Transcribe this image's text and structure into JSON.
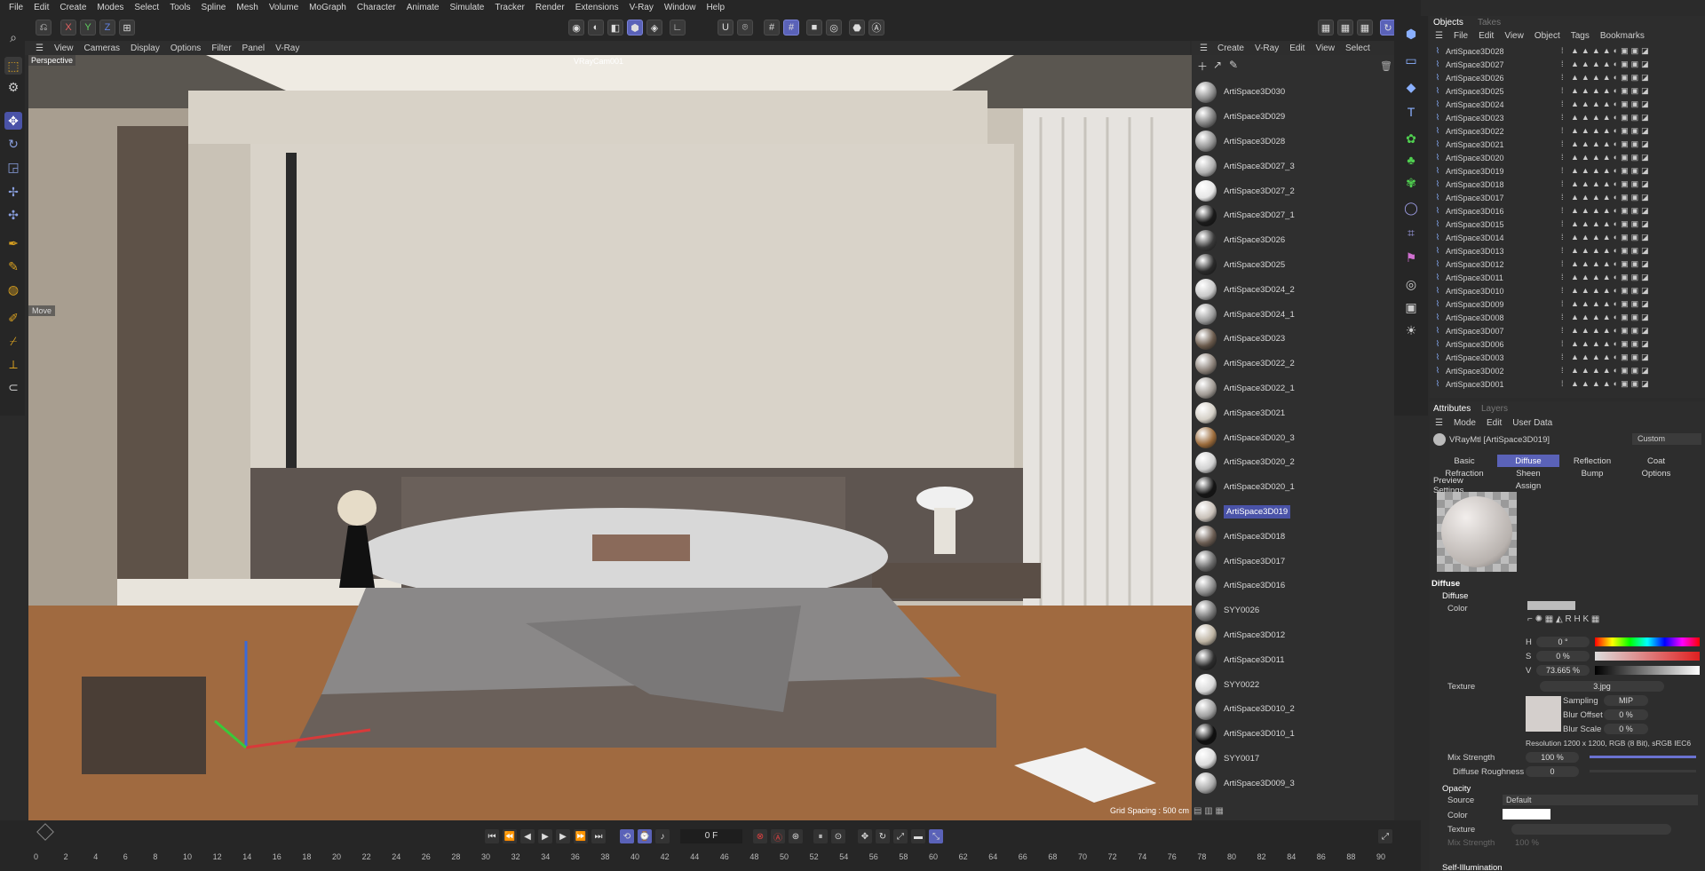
{
  "menu": [
    "File",
    "Edit",
    "Create",
    "Modes",
    "Select",
    "Tools",
    "Spline",
    "Mesh",
    "Volume",
    "MoGraph",
    "Character",
    "Animate",
    "Simulate",
    "Tracker",
    "Render",
    "Extensions",
    "V-Ray",
    "Window",
    "Help"
  ],
  "axis_buttons": [
    "X",
    "Y",
    "Z"
  ],
  "viewport_menu": [
    "View",
    "Cameras",
    "Display",
    "Options",
    "Filter",
    "Panel",
    "V-Ray"
  ],
  "viewport": {
    "name": "Perspective",
    "camera": "VRayCam001",
    "tool_tooltip": "Move",
    "grid_spacing": "Grid Spacing : 500 cm"
  },
  "material_menu": [
    "Create",
    "V-Ray",
    "Edit",
    "View",
    "Select"
  ],
  "materials": [
    {
      "name": "ArtiSpace3D030",
      "color": "#8a8a8a"
    },
    {
      "name": "ArtiSpace3D029",
      "color": "#7c7c7c"
    },
    {
      "name": "ArtiSpace3D028",
      "color": "#909090"
    },
    {
      "name": "ArtiSpace3D027_3",
      "color": "#b0b0b0"
    },
    {
      "name": "ArtiSpace3D027_2",
      "color": "#e6e6e6"
    },
    {
      "name": "ArtiSpace3D027_1",
      "color": "#1a1a1a"
    },
    {
      "name": "ArtiSpace3D026",
      "color": "#3a3a3a"
    },
    {
      "name": "ArtiSpace3D025",
      "color": "#2a2a2a"
    },
    {
      "name": "ArtiSpace3D024_2",
      "color": "#c8c8c8"
    },
    {
      "name": "ArtiSpace3D024_1",
      "color": "#9a9a9a"
    },
    {
      "name": "ArtiSpace3D023",
      "color": "#6a5a4c"
    },
    {
      "name": "ArtiSpace3D022_2",
      "color": "#8a8078"
    },
    {
      "name": "ArtiSpace3D022_1",
      "color": "#a09a94"
    },
    {
      "name": "ArtiSpace3D021",
      "color": "#d4cfc6"
    },
    {
      "name": "ArtiSpace3D020_3",
      "color": "#9a6a3a"
    },
    {
      "name": "ArtiSpace3D020_2",
      "color": "#d0d0d0"
    },
    {
      "name": "ArtiSpace3D020_1",
      "color": "#151515"
    },
    {
      "name": "ArtiSpace3D019",
      "color": "#c8c0b8",
      "selected": true
    },
    {
      "name": "ArtiSpace3D018",
      "color": "#6a5c52"
    },
    {
      "name": "ArtiSpace3D017",
      "color": "#6a6a6a"
    },
    {
      "name": "ArtiSpace3D016",
      "color": "#8a8a8a"
    },
    {
      "name": "SYY0026",
      "color": "#777777"
    },
    {
      "name": "ArtiSpace3D012",
      "color": "#bdb3a2"
    },
    {
      "name": "ArtiSpace3D011",
      "color": "#2d2d2d"
    },
    {
      "name": "SYY0022",
      "color": "#d8d8d8"
    },
    {
      "name": "ArtiSpace3D010_2",
      "color": "#a0a0a0"
    },
    {
      "name": "ArtiSpace3D010_1",
      "color": "#101010"
    },
    {
      "name": "SYY0017",
      "color": "#dcdcdc"
    },
    {
      "name": "ArtiSpace3D009_3",
      "color": "#a8a8a8"
    }
  ],
  "objects_panel": {
    "tabs": [
      "Objects",
      "Takes"
    ],
    "menu": [
      "File",
      "Edit",
      "View",
      "Object",
      "Tags",
      "Bookmarks"
    ],
    "rows": [
      "ArtiSpace3D028",
      "ArtiSpace3D027",
      "ArtiSpace3D026",
      "ArtiSpace3D025",
      "ArtiSpace3D024",
      "ArtiSpace3D023",
      "ArtiSpace3D022",
      "ArtiSpace3D021",
      "ArtiSpace3D020",
      "ArtiSpace3D019",
      "ArtiSpace3D018",
      "ArtiSpace3D017",
      "ArtiSpace3D016",
      "ArtiSpace3D015",
      "ArtiSpace3D014",
      "ArtiSpace3D013",
      "ArtiSpace3D012",
      "ArtiSpace3D011",
      "ArtiSpace3D010",
      "ArtiSpace3D009",
      "ArtiSpace3D008",
      "ArtiSpace3D007",
      "ArtiSpace3D006",
      "ArtiSpace3D003",
      "ArtiSpace3D002",
      "ArtiSpace3D001"
    ]
  },
  "attributes": {
    "tabs": [
      "Attributes",
      "Layers"
    ],
    "menu": [
      "Mode",
      "Edit",
      "User Data"
    ],
    "material_title": "VRayMtl [ArtiSpace3D019]",
    "preset": "Custom",
    "mat_tabs": [
      [
        "Basic",
        "Diffuse",
        "Reflection",
        "Coat"
      ],
      [
        "Refraction",
        "Sheen",
        "Bump",
        "Options"
      ],
      [
        "Preview Settings",
        "Assign"
      ]
    ],
    "section_diffuse": "Diffuse",
    "group_diffuse": "Diffuse",
    "color_label": "Color",
    "hsv": {
      "h_label": "H",
      "h": "0 °",
      "s_label": "S",
      "s": "0 %",
      "v_label": "V",
      "v": "73.665 %"
    },
    "texture_label": "Texture",
    "texture_file": "3.jpg",
    "sampling_label": "Sampling",
    "sampling": "MIP",
    "blur_offset_label": "Blur Offset",
    "blur_offset": "0 %",
    "blur_scale_label": "Blur Scale",
    "blur_scale": "0 %",
    "resolution": "Resolution 1200 x 1200, RGB (8 Bit), sRGB IEC6",
    "mix_strength_label": "Mix Strength",
    "mix_strength": "100 %",
    "diffuse_roughness_label": "Diffuse Roughness",
    "diffuse_roughness": "0",
    "opacity_label": "Opacity",
    "source_label": "Source",
    "source": "Default",
    "op_color_label": "Color",
    "op_texture_label": "Texture",
    "op_mix_label": "Mix Strength",
    "op_mix": "100 %",
    "self_illum_label": "Self-Illumination"
  },
  "timeline": {
    "frame": "0 F",
    "ticks": [
      "0",
      "2",
      "4",
      "6",
      "8",
      "10",
      "12",
      "14",
      "16",
      "18",
      "20",
      "22",
      "24",
      "26",
      "28",
      "30",
      "32",
      "34",
      "36",
      "38",
      "40",
      "42",
      "44",
      "46",
      "48",
      "50",
      "52",
      "54",
      "56",
      "58",
      "60",
      "62",
      "64",
      "66",
      "68",
      "70",
      "72",
      "74",
      "76",
      "78",
      "80",
      "82",
      "84",
      "86",
      "88",
      "90"
    ]
  }
}
